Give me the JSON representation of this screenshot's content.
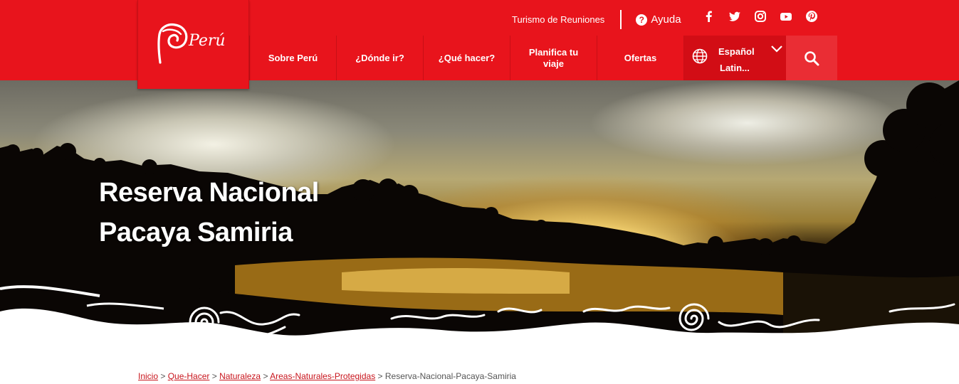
{
  "brand": {
    "logo_text": "Perú",
    "color": "#e8141c"
  },
  "top_bar": {
    "reuniones_label": "Turismo de Reuniones",
    "help_label": "Ayuda",
    "help_glyph": "?"
  },
  "social": [
    "facebook-icon",
    "twitter-icon",
    "instagram-icon",
    "youtube-icon",
    "pinterest-icon"
  ],
  "nav": {
    "items": [
      {
        "label": "Sobre Perú"
      },
      {
        "label": "¿Dónde ir?"
      },
      {
        "label": "¿Qué hacer?"
      },
      {
        "label": "Planifica tu viaje"
      },
      {
        "label": "Ofertas"
      }
    ],
    "language": {
      "line1": "Español",
      "line2": "Latin..."
    }
  },
  "hero": {
    "title_line1": "Reserva Nacional",
    "title_line2": "Pacaya Samiria"
  },
  "breadcrumb": {
    "links": [
      "Inicio",
      "Que-Hacer",
      "Naturaleza",
      "Areas-Naturales-Protegidas"
    ],
    "current": "Reserva-Nacional-Pacaya-Samiria",
    "separator": " > "
  }
}
